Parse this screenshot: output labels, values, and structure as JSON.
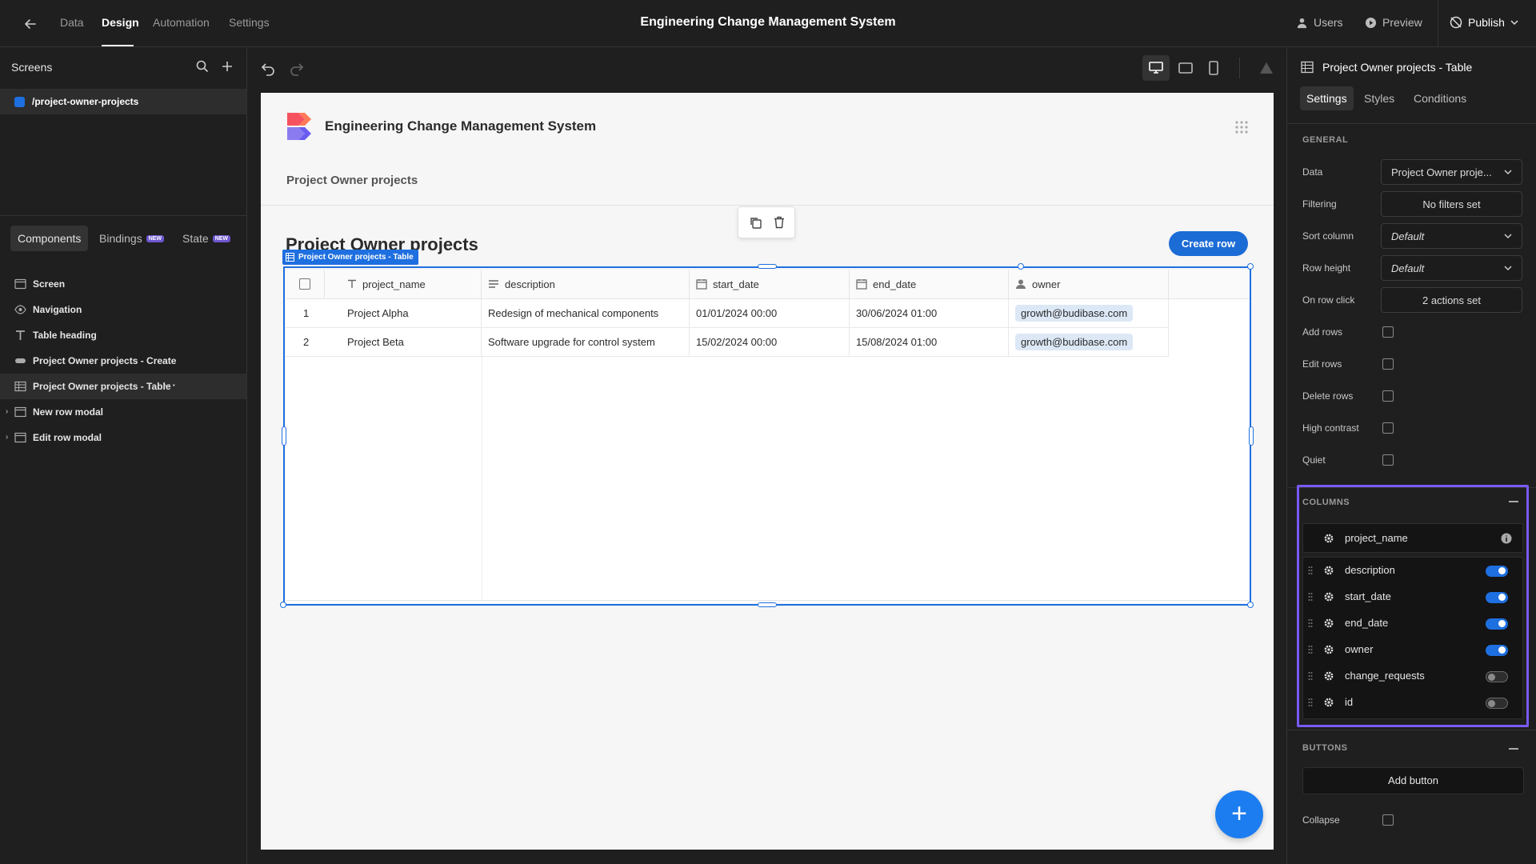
{
  "topbar": {
    "tabs": [
      "Data",
      "Design",
      "Automation",
      "Settings"
    ],
    "active_tab": "Design",
    "app_title": "Engineering Change Management System",
    "users_label": "Users",
    "preview_label": "Preview",
    "publish_label": "Publish"
  },
  "left": {
    "screens_title": "Screens",
    "screen_route": "/project-owner-projects",
    "tabs": {
      "components": "Components",
      "bindings": "Bindings",
      "state": "State",
      "new_badge": "NEW"
    },
    "components": [
      {
        "label": "Screen",
        "icon": "screen-icon"
      },
      {
        "label": "Navigation",
        "icon": "eye-icon"
      },
      {
        "label": "Table heading",
        "icon": "text-icon"
      },
      {
        "label": "Project Owner projects - Create",
        "icon": "button-icon"
      },
      {
        "label": "Project Owner projects - Table",
        "icon": "table-icon",
        "selected": true
      },
      {
        "label": "New row modal",
        "icon": "modal-icon",
        "collapsed": true
      },
      {
        "label": "Edit row modal",
        "icon": "modal-icon",
        "collapsed": true
      }
    ]
  },
  "canvas": {
    "app_title": "Engineering Change Management System",
    "nav_link": "Project Owner projects",
    "heading": "Project Owner projects",
    "create_row_label": "Create row",
    "selection_tag": "Project Owner projects - Table",
    "fab_label": "+",
    "table": {
      "columns": [
        {
          "name": "project_name",
          "icon": "text-type-icon"
        },
        {
          "name": "description",
          "icon": "longform-icon"
        },
        {
          "name": "start_date",
          "icon": "calendar-icon"
        },
        {
          "name": "end_date",
          "icon": "calendar-icon"
        },
        {
          "name": "owner",
          "icon": "user-icon"
        }
      ],
      "rows": [
        {
          "num": "1",
          "project_name": "Project Alpha",
          "description": "Redesign of mechanical components",
          "start_date": "01/01/2024 00:00",
          "end_date": "30/06/2024 01:00",
          "owner": "growth@budibase.com"
        },
        {
          "num": "2",
          "project_name": "Project Beta",
          "description": "Software upgrade for control system",
          "start_date": "15/02/2024 00:00",
          "end_date": "15/08/2024 01:00",
          "owner": "growth@budibase.com"
        }
      ]
    }
  },
  "right": {
    "title": "Project Owner projects - Table",
    "tabs": [
      "Settings",
      "Styles",
      "Conditions"
    ],
    "active_tab": "Settings",
    "general_title": "GENERAL",
    "fields": {
      "data": {
        "label": "Data",
        "value": "Project Owner proje..."
      },
      "filtering": {
        "label": "Filtering",
        "value": "No filters set"
      },
      "sort_column": {
        "label": "Sort column",
        "value": "Default"
      },
      "row_height": {
        "label": "Row height",
        "value": "Default"
      },
      "on_row_click": {
        "label": "On row click",
        "value": "2 actions set"
      }
    },
    "checkboxes": [
      {
        "label": "Add rows",
        "checked": false
      },
      {
        "label": "Edit rows",
        "checked": false
      },
      {
        "label": "Delete rows",
        "checked": false
      },
      {
        "label": "High contrast",
        "checked": false
      },
      {
        "label": "Quiet",
        "checked": false
      }
    ],
    "columns_title": "COLUMNS",
    "primary_column": "project_name",
    "column_items": [
      {
        "name": "description",
        "enabled": true
      },
      {
        "name": "start_date",
        "enabled": true
      },
      {
        "name": "end_date",
        "enabled": true
      },
      {
        "name": "owner",
        "enabled": true
      },
      {
        "name": "change_requests",
        "enabled": false
      },
      {
        "name": "id",
        "enabled": false
      }
    ],
    "buttons_title": "BUTTONS",
    "add_button_label": "Add button",
    "collapse_label": "Collapse"
  },
  "colors": {
    "accent": "#1e6fe0",
    "highlight": "#7a5af8",
    "create_button": "#1c6cd6",
    "fab": "#1c7df0"
  }
}
